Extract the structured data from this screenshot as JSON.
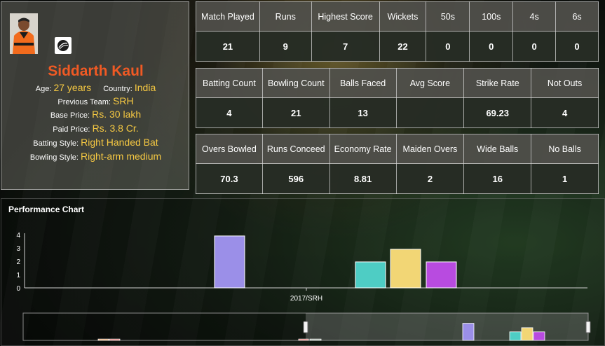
{
  "player": {
    "name": "Siddarth Kaul",
    "age_label": "Age:",
    "age": "27 years",
    "country_label": "Country:",
    "country": "India",
    "previous_team_label": "Previous Team:",
    "previous_team": "SRH",
    "base_price_label": "Base Price:",
    "base_price": "Rs. 30 lakh",
    "paid_price_label": "Paid Price:",
    "paid_price": "Rs. 3.8 Cr.",
    "batting_style_label": "Batting Style:",
    "batting_style": "Right Handed Bat",
    "bowling_style_label": "Bowling Style:",
    "bowling_style": "Right-arm medium"
  },
  "table1": {
    "headers": [
      "Match Played",
      "Runs",
      "Highest Score",
      "Wickets",
      "50s",
      "100s",
      "4s",
      "6s"
    ],
    "values": [
      "21",
      "9",
      "7",
      "22",
      "0",
      "0",
      "0",
      "0"
    ]
  },
  "table2": {
    "headers": [
      "Batting Count",
      "Bowling Count",
      "Balls Faced",
      "Avg Score",
      "Strike Rate",
      "Not Outs"
    ],
    "values": [
      "4",
      "21",
      "13",
      "",
      "69.23",
      "4"
    ]
  },
  "table3": {
    "headers": [
      "Overs Bowled",
      "Runs Conceed",
      "Economy Rate",
      "Maiden Overs",
      "Wide Balls",
      "No Balls"
    ],
    "values": [
      "70.3",
      "596",
      "8.81",
      "2",
      "16",
      "1"
    ]
  },
  "chart": {
    "title": "Performance Chart"
  },
  "chart_data": {
    "type": "bar",
    "categories": [
      "2017/SRH"
    ],
    "ylim": [
      0,
      4
    ],
    "yticks": [
      "0",
      "1",
      "2",
      "3",
      "4"
    ],
    "bars": [
      {
        "value": 3.9,
        "color": "#9b8fe8"
      },
      {
        "value": 1.95,
        "color": "#4ecdc4"
      },
      {
        "value": 2.9,
        "color": "#f2d675"
      },
      {
        "value": 1.95,
        "color": "#b84be0"
      }
    ],
    "overview_bars": [
      {
        "value": 0.3,
        "color": "#e08a4a"
      },
      {
        "value": 0.3,
        "color": "#d9534f"
      },
      {
        "value": 0.3,
        "color": "#d9534f"
      },
      {
        "value": 0.3,
        "color": "#9aa39a"
      },
      {
        "value": 3.9,
        "color": "#9b8fe8"
      },
      {
        "value": 1.95,
        "color": "#4ecdc4"
      },
      {
        "value": 2.9,
        "color": "#f2d675"
      },
      {
        "value": 1.95,
        "color": "#b84be0"
      }
    ],
    "brush_range": [
      0.5,
      1.0
    ]
  },
  "colors": {
    "name": "#f05a24",
    "value": "#f5c842"
  },
  "icons": {
    "avatar": "player-photo",
    "team_logo": "cricket-ball-logo"
  }
}
